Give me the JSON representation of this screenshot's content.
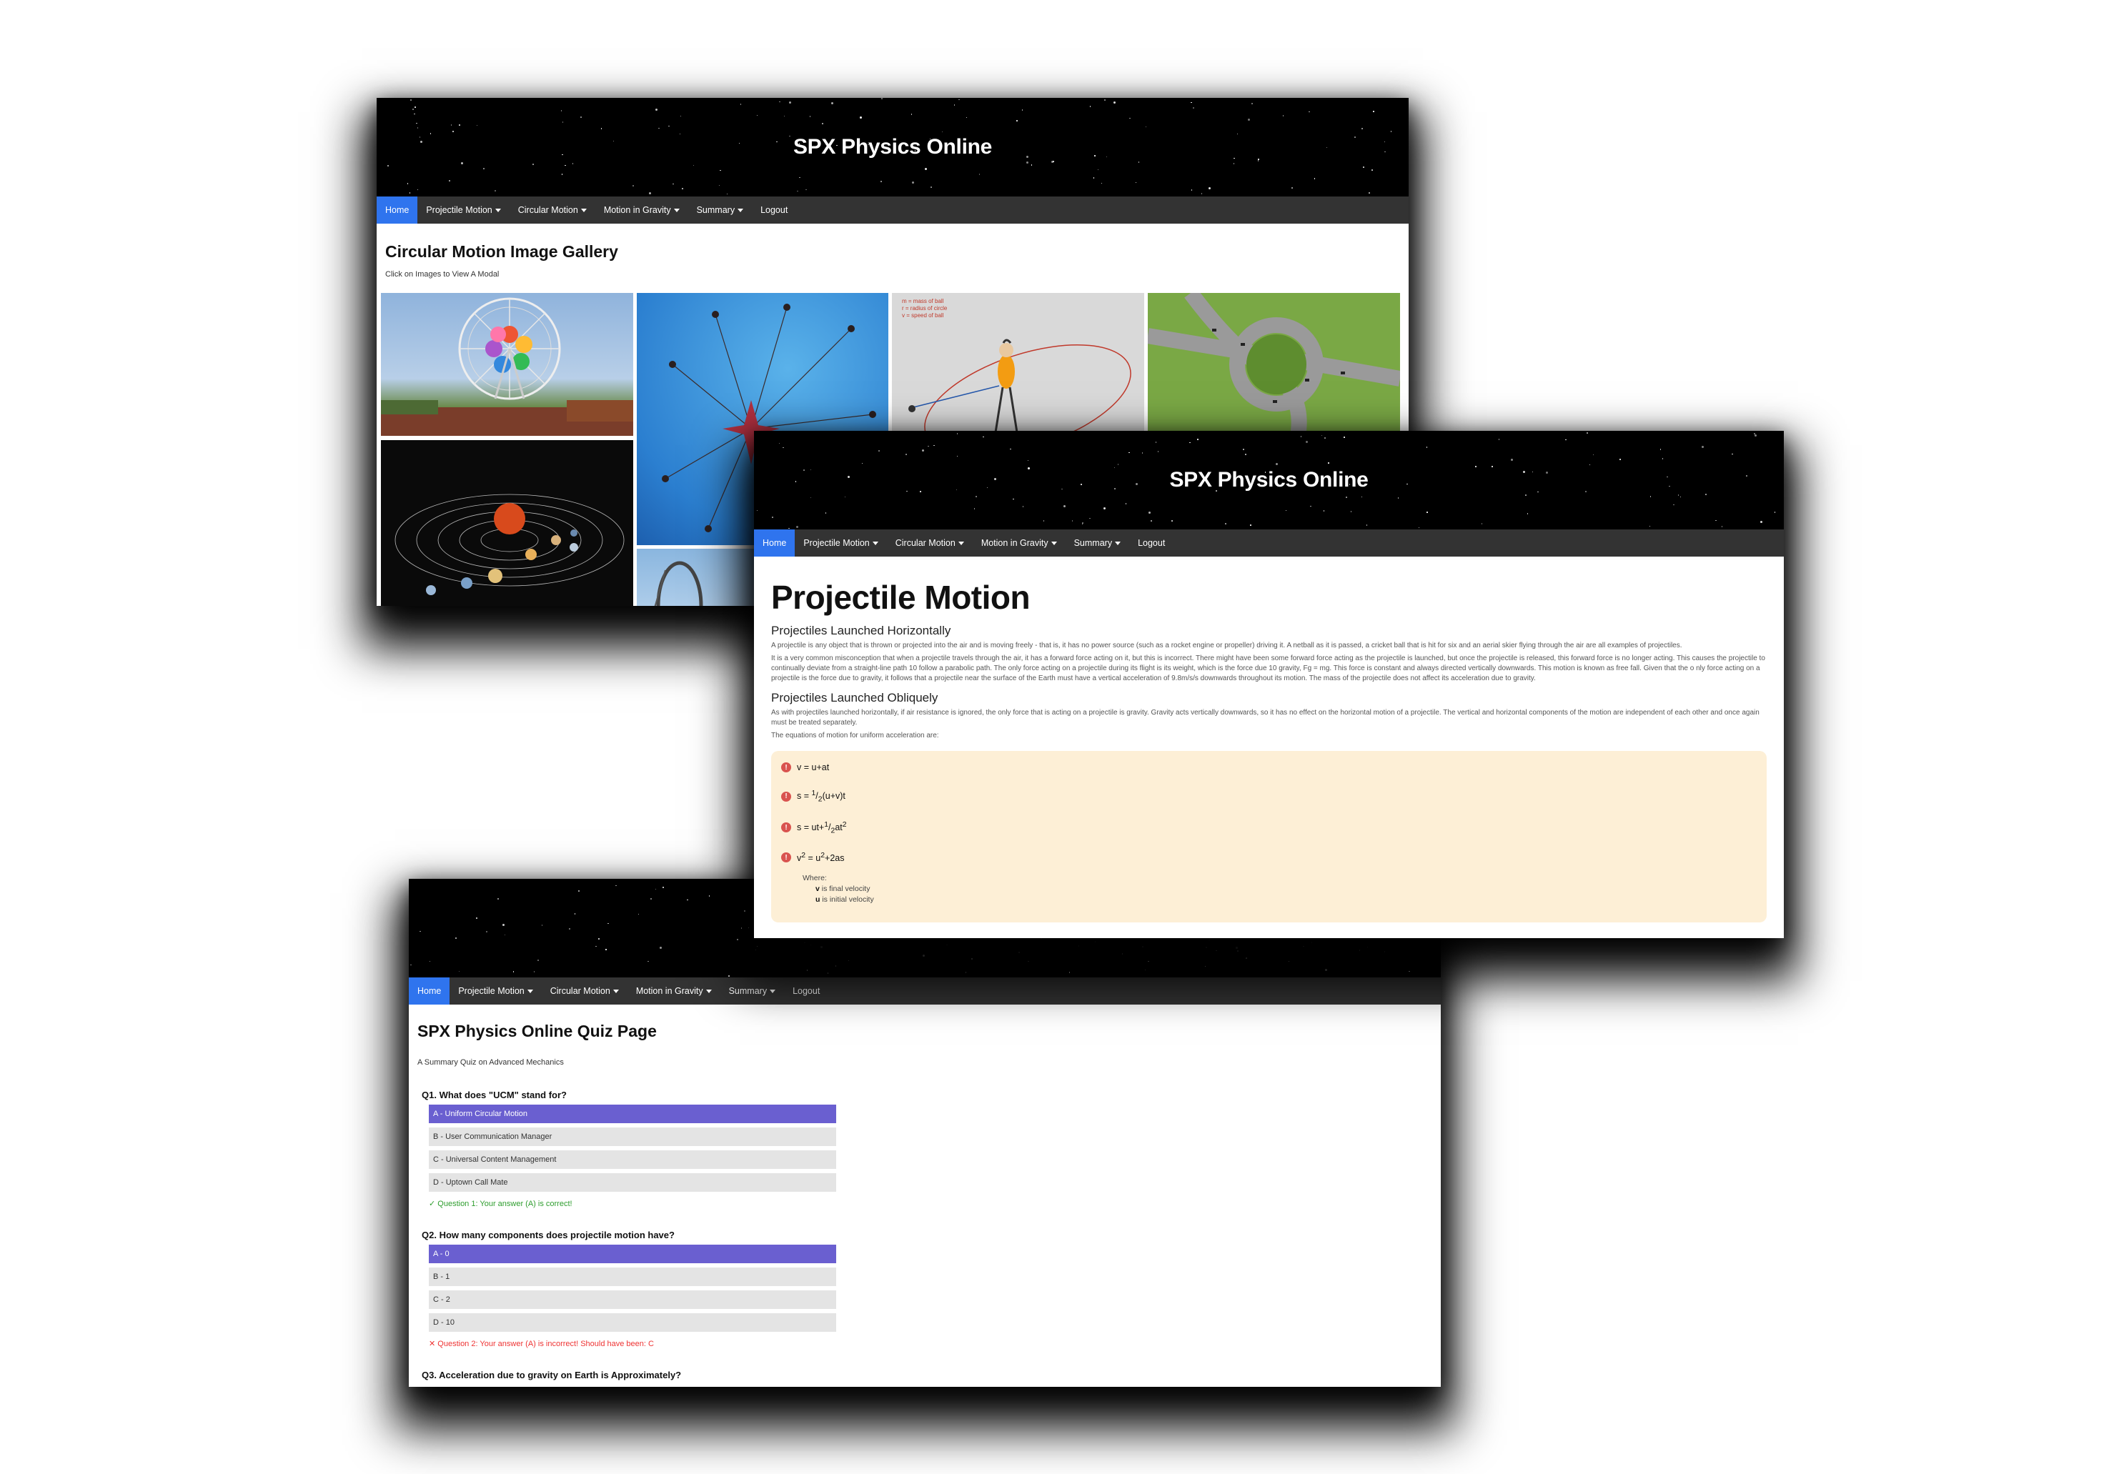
{
  "site": {
    "title": "SPX Physics Online"
  },
  "nav": {
    "home": "Home",
    "projectile": "Projectile Motion",
    "circular": "Circular Motion",
    "gravity": "Motion in Gravity",
    "summary": "Summary",
    "logout": "Logout"
  },
  "gallery": {
    "title": "Circular Motion Image Gallery",
    "subtitle": "Click on Images to View A Modal",
    "tiles": [
      "ferris-wheel",
      "swing-ride",
      "hammer-throw-diagram",
      "roundabout-aerial",
      "solar-system",
      "roller-coaster"
    ],
    "diagram_labels": [
      "m = mass of ball",
      "r = radius of circle",
      "v = speed of ball"
    ]
  },
  "projectile": {
    "heading": "Projectile Motion",
    "h_horizontal": "Projectiles Launched Horizontally",
    "p1": "A projectile is any object that is thrown or projected into the air and is moving freely - that is, it has no power source (such as a rocket engine or propeller) driving it. A netball as it is passed, a cricket ball that is hit for six and an aerial skier flying through the air are all examples of projectiles.",
    "p2": "It is a very common misconception that when a projectile travels through the air, it has a forward force acting on it, but this is incorrect. There might have been some forward force acting as the projectile is launched, but once the projectile is released, this forward force is no longer acting. This causes the projectile to continually deviate from a straight-line path 10 follow a parabolic path. The only force acting on a projectile during its flight is its weight, which is the force due 10 gravity, Fg = mg. This force is constant and always directed vertically downwards. This motion is known as free fall. Given that the o nly force acting on a projectile is the force due to gravity, it follows that a projectile near the surface of the Earth must have a vertical acceleration of 9.8m/s/s downwards throughout its motion. The mass of the projectile does not affect its acceleration due to gravity.",
    "h_oblique": "Projectiles Launched Obliquely",
    "p3": "As with projectiles launched horizontally, if air resistance is ignored, the only force that is acting on a projectile is gravity. Gravity acts vertically downwards, so it has no effect on the horizontal motion of a projectile. The vertical and horizontal components of the motion are independent of each other and once again must be treated separately.",
    "p4": "The equations of motion for uniform acceleration are:",
    "eq_icon": "!",
    "where": "Where:",
    "v_sym": "v",
    "v_desc": "is final velocity",
    "u_sym": "u",
    "u_desc": "is initial velocity"
  },
  "quiz": {
    "title": "SPX Physics Online Quiz Page",
    "subtitle": "A Summary Quiz on Advanced Mechanics",
    "q1": "Q1. What does \"UCM\" stand for?",
    "q1_options": [
      "A - Uniform Circular Motion",
      "B - User Communication Manager",
      "C - Universal Content Management",
      "D - Uptown Call Mate"
    ],
    "q1_feedback": "✓ Question 1: Your answer (A) is correct!",
    "q2": "Q2. How many components does projectile motion have?",
    "q2_options": [
      "A - 0",
      "B - 1",
      "C - 2",
      "D - 10"
    ],
    "q2_feedback": "✕ Question 2: Your answer (A) is incorrect! Should have been: C",
    "q3": "Q3. Acceleration due to gravity on Earth is Approximately?"
  }
}
